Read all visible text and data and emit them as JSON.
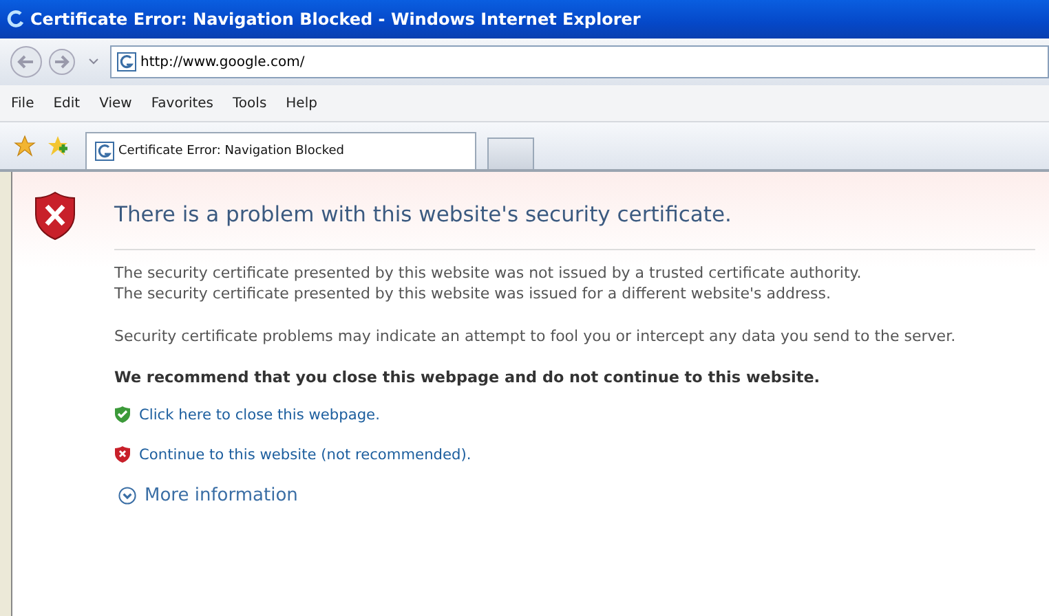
{
  "window": {
    "title": "Certificate Error: Navigation Blocked - Windows Internet Explorer"
  },
  "address_bar": {
    "url": "http://www.google.com/"
  },
  "menu": [
    "File",
    "Edit",
    "View",
    "Favorites",
    "Tools",
    "Help"
  ],
  "tabs": [
    {
      "label": "Certificate Error: Navigation Blocked",
      "selected": true
    },
    {
      "selected": false
    }
  ],
  "page": {
    "heading": "There is a problem with this website's security certificate.",
    "paragraphs": [
      "The security certificate presented by this website was not issued by a trusted certificate authority.\nThe security certificate presented by this website was issued for a different website's address.",
      "Security certificate problems may indicate an attempt to fool you or intercept any data you send to the server."
    ],
    "recommendation": "We recommend that you close this webpage and do not continue to this website.",
    "links": [
      {
        "kind": "safe",
        "label": "Click here to close this webpage."
      },
      {
        "kind": "unsafe",
        "label": "Continue to this website (not recommended)."
      }
    ],
    "more": "More information"
  }
}
